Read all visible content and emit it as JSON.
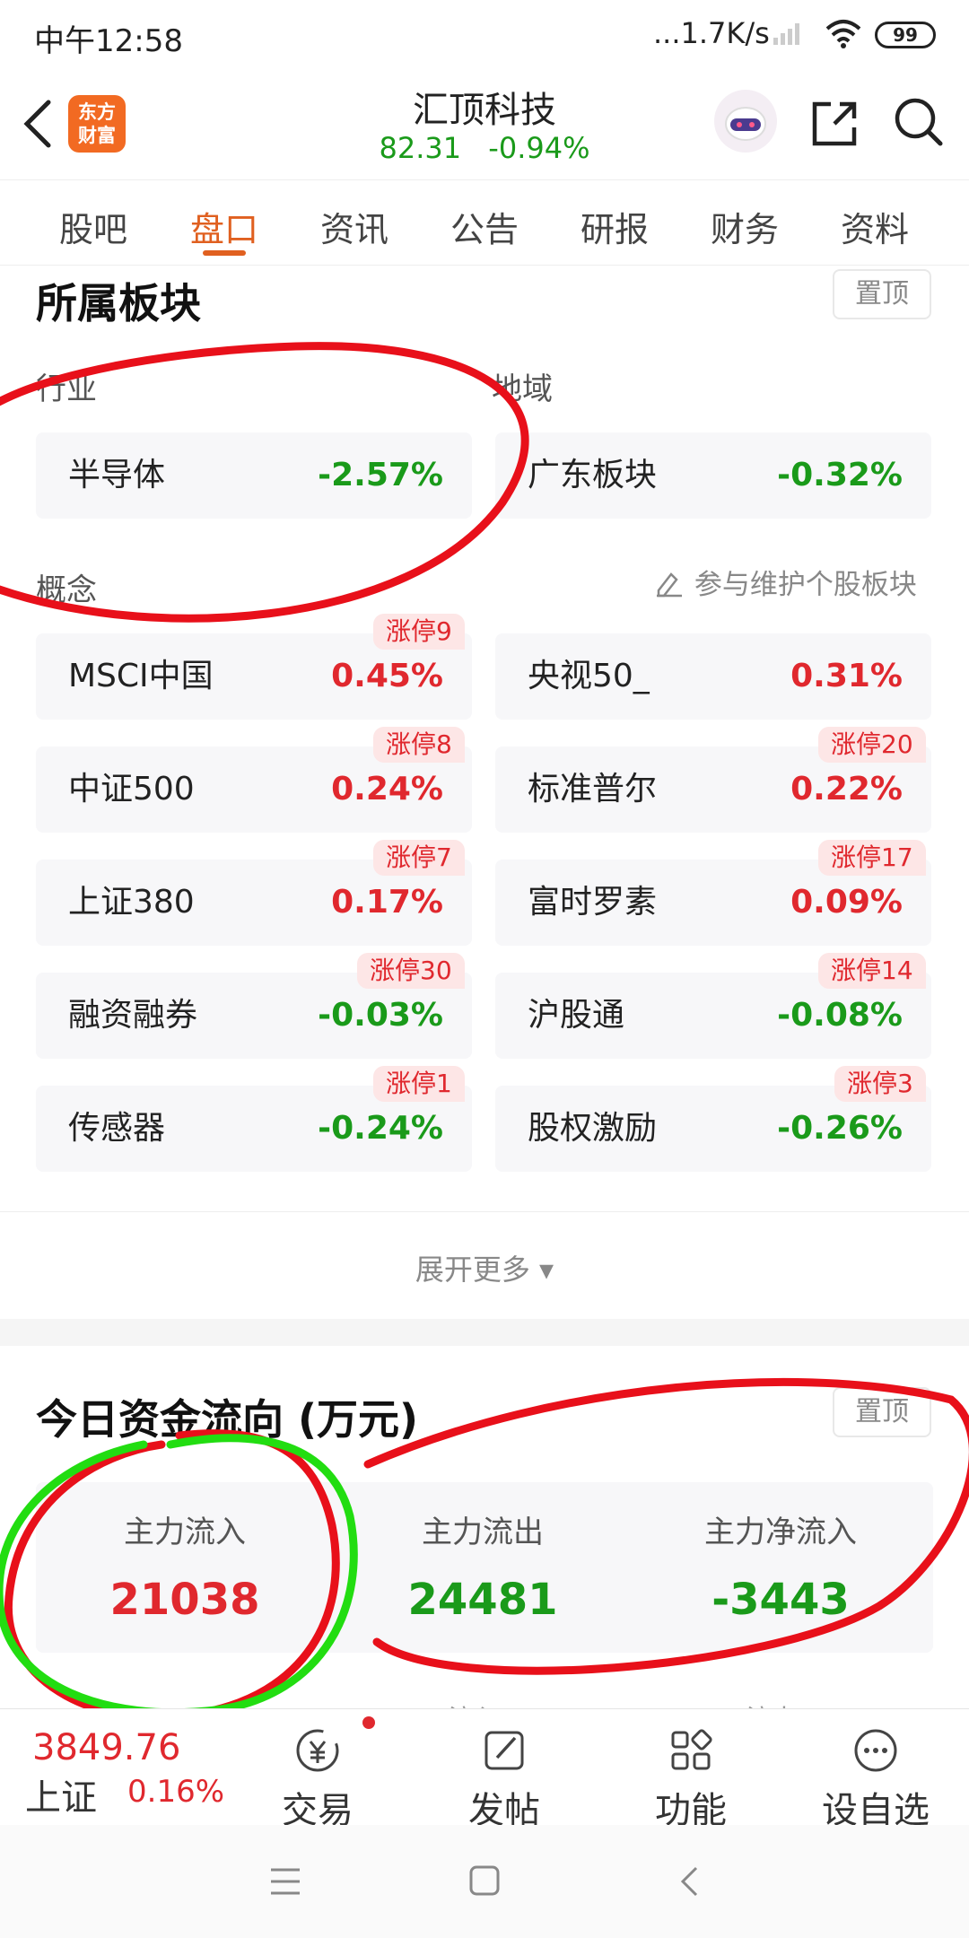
{
  "status_bar": {
    "time": "中午12:58",
    "network_speed": "...1.7K/s",
    "battery": "99"
  },
  "header": {
    "app_logo": "东方\n财富",
    "stock_name": "汇顶科技",
    "price": "82.31",
    "change": "-0.94%",
    "icons": [
      "back-icon",
      "robot-icon",
      "share-icon",
      "search-icon"
    ]
  },
  "tabs": [
    "股吧",
    "盘口",
    "资讯",
    "公告",
    "研报",
    "财务",
    "资料"
  ],
  "active_tab": "盘口",
  "sector_section": {
    "title": "所属板块",
    "pin_label": "置顶",
    "industry_label": "行业",
    "region_label": "地域",
    "industry": {
      "name": "半导体",
      "value": "-2.57%"
    },
    "region": {
      "name": "广东板块",
      "value": "-0.32%"
    },
    "concept_label": "概念",
    "maintain_label": "参与维护个股板块",
    "concepts": [
      {
        "name": "MSCI中国",
        "value": "0.45%",
        "tag": "涨停9"
      },
      {
        "name": "央视50_",
        "value": "0.31%",
        "tag": ""
      },
      {
        "name": "中证500",
        "value": "0.24%",
        "tag": "涨停8"
      },
      {
        "name": "标准普尔",
        "value": "0.22%",
        "tag": "涨停20"
      },
      {
        "name": "上证380",
        "value": "0.17%",
        "tag": "涨停7"
      },
      {
        "name": "富时罗素",
        "value": "0.09%",
        "tag": "涨停17"
      },
      {
        "name": "融资融券",
        "value": "-0.03%",
        "tag": "涨停30"
      },
      {
        "name": "沪股通",
        "value": "-0.08%",
        "tag": "涨停14"
      },
      {
        "name": "传感器",
        "value": "-0.24%",
        "tag": "涨停1"
      },
      {
        "name": "股权激励",
        "value": "-0.26%",
        "tag": "涨停3"
      }
    ],
    "expand_label": "展开更多 ▾"
  },
  "fund_flow_section": {
    "title": "今日资金流向 (万元)",
    "pin_label": "置顶",
    "inflow_label": "主力流入",
    "inflow_value": "21038",
    "outflow_label": "主力流出",
    "outflow_value": "24481",
    "net_label": "主力净流入",
    "net_value": "-3443",
    "peek_labels": [
      "流入",
      "流出"
    ]
  },
  "bottom_bar": {
    "index_value": "3849.76",
    "index_name": "上证",
    "index_change": "0.16%",
    "nav": [
      {
        "label": "交易",
        "icon": "yen-circle-icon"
      },
      {
        "label": "发帖",
        "icon": "edit-icon"
      },
      {
        "label": "功能",
        "icon": "grid-icon"
      },
      {
        "label": "设自选",
        "icon": "more-dots-icon"
      }
    ]
  },
  "colors": {
    "up": "#e0282e",
    "down": "#1a9a1a",
    "accent": "#e06020",
    "annotation_red": "#e8101a",
    "annotation_green": "#22dd11"
  }
}
